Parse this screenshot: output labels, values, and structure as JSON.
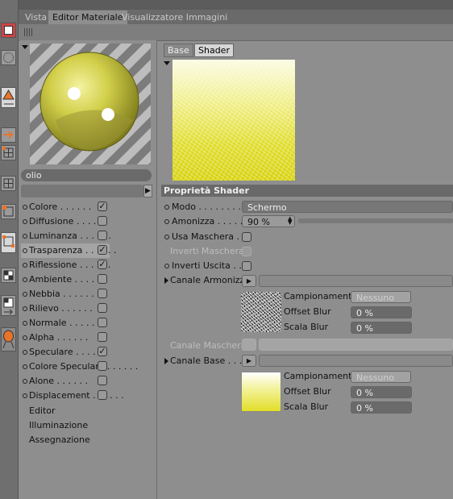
{
  "tabs": [
    "Vista",
    "Editor Materiale",
    "Visualizzatore Immagini"
  ],
  "material": {
    "name": "olio"
  },
  "channels": [
    {
      "label": "Colore",
      "checked": true,
      "selected": false
    },
    {
      "label": "Diffusione",
      "checked": false,
      "selected": false
    },
    {
      "label": "Luminanza",
      "checked": false,
      "selected": false
    },
    {
      "label": "Trasparenza",
      "checked": true,
      "selected": true
    },
    {
      "label": "Riflessione",
      "checked": true,
      "selected": false
    },
    {
      "label": "Ambiente",
      "checked": false,
      "selected": false
    },
    {
      "label": "Nebbia",
      "checked": false,
      "selected": false
    },
    {
      "label": "Rilievo",
      "checked": false,
      "selected": false
    },
    {
      "label": "Normale",
      "checked": false,
      "selected": false
    },
    {
      "label": "Alpha",
      "checked": false,
      "selected": false
    },
    {
      "label": "Speculare",
      "checked": true,
      "selected": false
    },
    {
      "label": "Colore Speculare",
      "checked": false,
      "selected": false
    },
    {
      "label": "Alone",
      "checked": false,
      "selected": false
    },
    {
      "label": "Displacement",
      "checked": false,
      "selected": false
    }
  ],
  "extra_sections": [
    "Editor",
    "Illuminazione",
    "Assegnazione"
  ],
  "subtabs": [
    "Base",
    "Shader"
  ],
  "section_title": "Proprietà Shader",
  "props": {
    "modo_label": "Modo",
    "modo_value": "Schermo",
    "amonizza_label": "Amonizza",
    "amonizza_value": "90 %",
    "usa_maschera_label": "Usa Maschera",
    "inverti_maschera_label": "Inverti Maschera",
    "inverti_uscita_label": "Inverti Uscita",
    "canale_armonizza_label": "Canale Armonizza",
    "canale_maschera_label": "Canale Maschera",
    "canale_base_label": "Canale Base"
  },
  "sampling": {
    "campionamento_label": "Campionamento",
    "campionamento_value": "Nessuno",
    "offset_label": "Offset Blur",
    "offset_value": "0 %",
    "scala_label": "Scala Blur",
    "scala_value": "0 %"
  },
  "colors": {
    "accent_yellow": "#e0dc2c",
    "selected_row": "#a4a4a4"
  }
}
